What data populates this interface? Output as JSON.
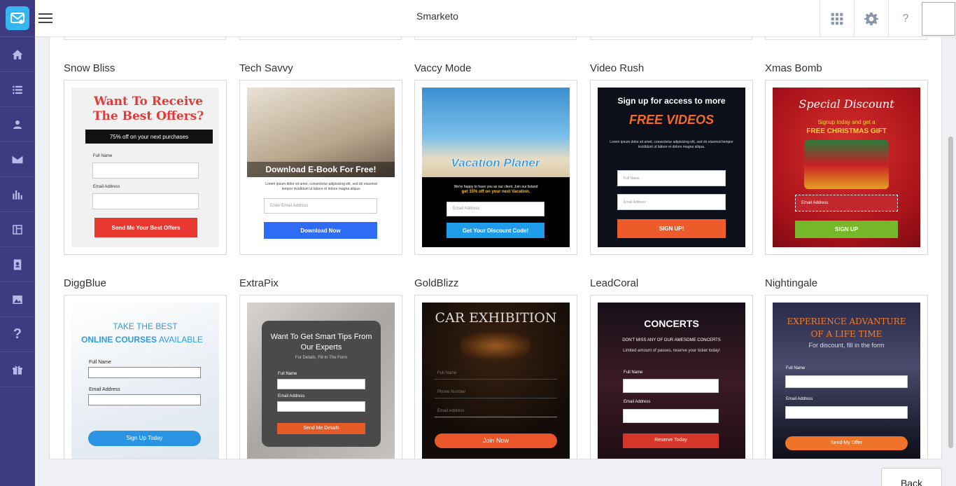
{
  "app": {
    "title": "Smarketo"
  },
  "sidebar": {
    "items": [
      {
        "icon": "home-icon"
      },
      {
        "icon": "list-icon"
      },
      {
        "icon": "user-icon"
      },
      {
        "icon": "mail-icon"
      },
      {
        "icon": "chart-icon"
      },
      {
        "icon": "layout-icon"
      },
      {
        "icon": "contact-book-icon"
      },
      {
        "icon": "image-icon"
      },
      {
        "icon": "help-icon"
      },
      {
        "icon": "gift-icon"
      }
    ]
  },
  "header": {
    "help_label": "?"
  },
  "templates": [
    {
      "name": "Snow Bliss",
      "headline": "Want To Receive The Best Offers?",
      "bar": "75% off on your next purchases",
      "field1": "Full Name",
      "field2": "Email Address",
      "button": "Send Me Your Best Offers"
    },
    {
      "name": "Tech Savvy",
      "headline": "Download E-Book For Free!",
      "body": "Lorem ipsum dolor sit amet, consectetur adipisicing elit, sed do eiusmod tempor incididunt ut labore et dolore magna aliqua.",
      "placeholder": "Enter Email Address",
      "button": "Download Now"
    },
    {
      "name": "Vaccy Mode",
      "headline": "Vacation Planer",
      "body": "We're happy to have you as our client. Join our listand",
      "highlight": "get 15% off on your next Vacation.",
      "placeholder": "Email Address",
      "button": "Get Your Discount Code!"
    },
    {
      "name": "Video Rush",
      "headline": "Sign up for access to more",
      "headline2": "FREE VIDEOS",
      "body": "Lorem ipsum dolor sit amet, consectetur adipisicing elit, sed do eiusmod tempor incididunt ut labore et dolore magna aliqua.",
      "placeholder1": "Full Name",
      "placeholder2": "Email Address",
      "button": "SIGN UP!"
    },
    {
      "name": "Xmas Bomb",
      "headline": "Special Discount",
      "sub": "Signup today and get a",
      "sub2": "FREE CHRISTMAS GIFT",
      "placeholder": "Email Address",
      "button": "SIGN UP"
    },
    {
      "name": "DiggBlue",
      "headline": "TAKE THE BEST",
      "headline_bold": "ONLINE COURSES",
      "headline_end": "AVAILABLE",
      "field1": "Full Name",
      "field2": "Email Address",
      "button": "Sign Up Today"
    },
    {
      "name": "ExtraPix",
      "headline": "Want To Get Smart Tips From Our Experts",
      "sub": "For Details, Fill In The Form",
      "field1": "Full Name",
      "field2": "Email Address",
      "button": "Send Me Details"
    },
    {
      "name": "GoldBlizz",
      "headline": "CAR EXHIBITION",
      "field1": "Full Name",
      "field2": "Phone Number",
      "field3": "Email Address",
      "button": "Join Now"
    },
    {
      "name": "LeadCoral",
      "headline": "CONCERTS",
      "sub": "DON'T MISS ANY OF OUR AWESOME CONCERTS",
      "sub2": "Limited amount of passes, reserve your ticket today!",
      "field1": "Full Name",
      "field2": "Email Address",
      "button": "Reserve Today"
    },
    {
      "name": "Nightingale",
      "headline": "EXPERIENCE ADVANTURE OF A LIFE TIME",
      "sub": "For discount, fill in the form",
      "field1": "Full Name",
      "field2": "Email Address",
      "button": "Send My Offer"
    }
  ],
  "footer": {
    "back_label": "Back"
  },
  "colors": {
    "sidebar": "#3d3c82",
    "accent": "#35b6f1"
  }
}
